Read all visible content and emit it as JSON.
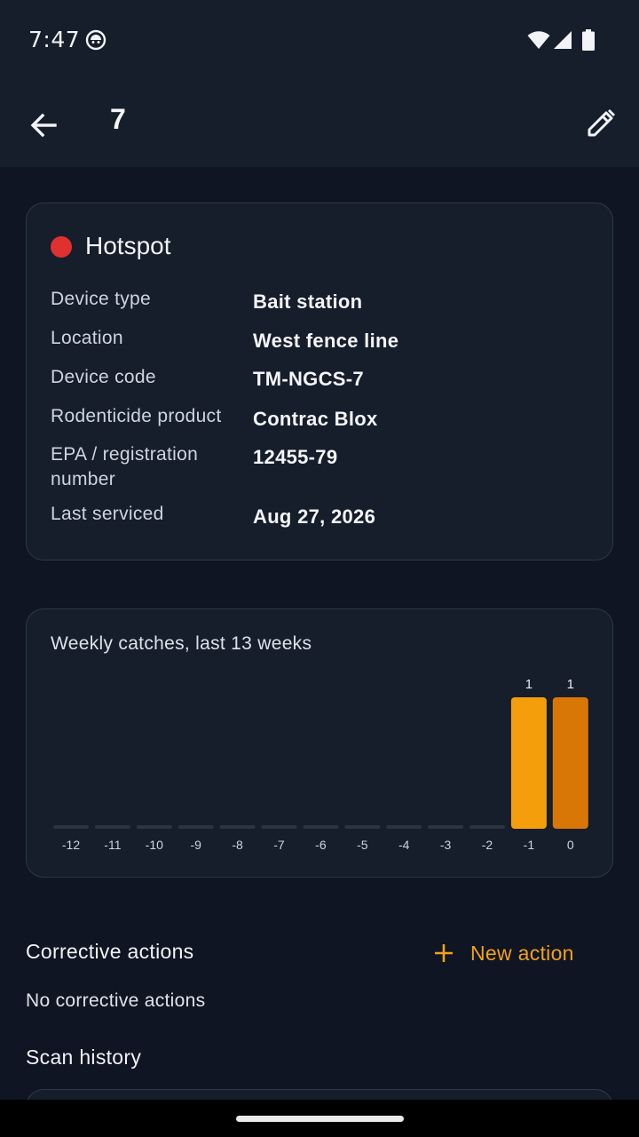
{
  "status_bar": {
    "time": "7:47"
  },
  "app_bar": {
    "title": "7"
  },
  "device": {
    "status": "Hotspot",
    "status_color": "#e03131",
    "rows": [
      {
        "label": "Device type",
        "value": "Bait station"
      },
      {
        "label": "Location",
        "value": "West fence line"
      },
      {
        "label": "Device code",
        "value": "TM-NGCS-7"
      },
      {
        "label": "Rodenticide product",
        "value": "Contrac Blox"
      },
      {
        "label": "EPA / registration number",
        "value": "12455-79"
      },
      {
        "label": "Last serviced",
        "value": "Aug 27, 2026"
      }
    ]
  },
  "chart_data": {
    "type": "bar",
    "title": "Weekly catches, last 13 weeks",
    "categories": [
      "-12",
      "-11",
      "-10",
      "-9",
      "-8",
      "-7",
      "-6",
      "-5",
      "-4",
      "-3",
      "-2",
      "-1",
      "0"
    ],
    "values": [
      0,
      0,
      0,
      0,
      0,
      0,
      0,
      0,
      0,
      0,
      0,
      1,
      1
    ],
    "ylim": [
      0,
      1
    ],
    "bar_colors": {
      "previous": "#f59e0b",
      "current": "#d97706",
      "zero": "#2b3443"
    }
  },
  "corrective_actions": {
    "title": "Corrective actions",
    "new_action_label": "New action",
    "empty_text": "No corrective actions",
    "accent": "#f0a21a"
  },
  "scan_history": {
    "title": "Scan history"
  }
}
